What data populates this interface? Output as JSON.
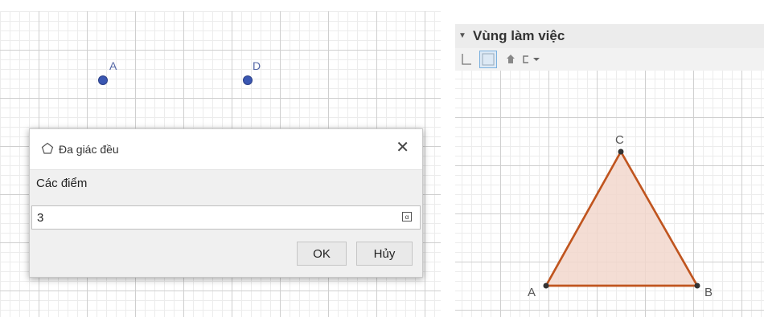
{
  "left_canvas": {
    "points": [
      {
        "label": "A"
      },
      {
        "label": "D"
      }
    ]
  },
  "dialog": {
    "title": "Đa giác đều",
    "icon": "polygon-icon",
    "close_symbol": "✕",
    "field_label": "Các điểm",
    "input_value": "3",
    "ok_label": "OK",
    "cancel_label": "Hủy"
  },
  "graphics_view": {
    "header_title": "Vùng làm việc",
    "toolbar_icons": [
      "axes-icon",
      "grid-icon",
      "home-icon",
      "style-menu-icon"
    ],
    "triangle": {
      "vertices": [
        "A",
        "B",
        "C"
      ],
      "fill_color": "#f2d7cc",
      "edge_color": "#c0551f"
    }
  },
  "colors": {
    "point_blue": "#3a57b2",
    "triangle_edge": "#c0551f",
    "triangle_fill": "#f2d7cc"
  }
}
